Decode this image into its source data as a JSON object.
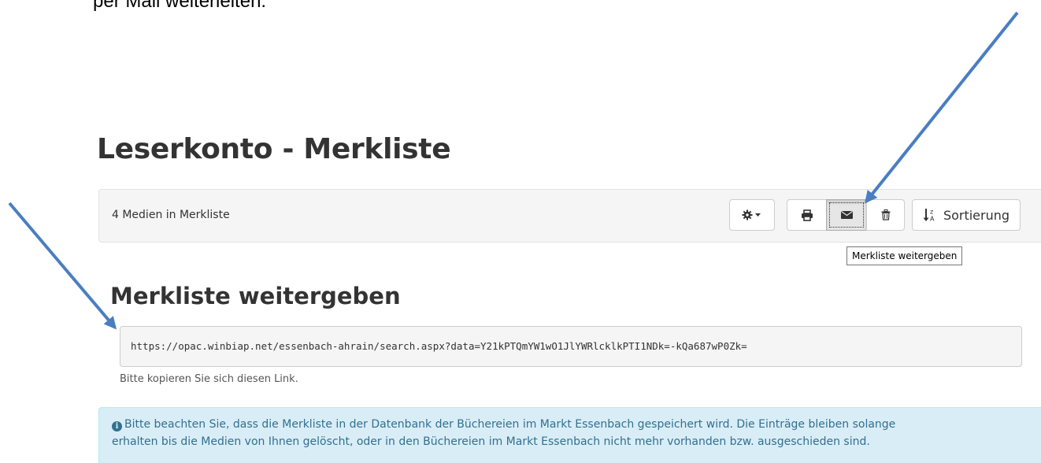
{
  "document": {
    "caption_fragment": "per Mail weiterleiten."
  },
  "page": {
    "title": "Leserkonto - Merkliste"
  },
  "toolbar": {
    "media_count": "4 Medien in Merkliste",
    "settings_icon": "gear-icon",
    "print_icon": "print-icon",
    "mail_icon": "envelope-icon",
    "delete_icon": "trash-icon",
    "sort_icon": "sort-alpha-icon",
    "sort_label": "Sortierung",
    "tooltip": "Merkliste weitergeben"
  },
  "share": {
    "heading": "Merkliste weitergeben",
    "link": "https://opac.winbiap.net/essenbach-ahrain/search.aspx?data=Y21kPTQmYW1wO1JlYWRlcklkPTI1NDk=-kQa687wP0Zk=",
    "hint": "Bitte kopieren Sie sich diesen Link."
  },
  "info": {
    "icon": "info-circle-icon",
    "line1": "Bitte beachten Sie, dass die Merkliste in der Datenbank der Büchereien im Markt Essenbach gespeichert wird. Die Einträge bleiben solange",
    "line2": "erhalten bis die Medien von Ihnen gelöscht, oder in den Büchereien im Markt Essenbach nicht mehr vorhanden bzw. ausgeschieden sind."
  },
  "colors": {
    "arrow": "#4a7ec2",
    "info_background": "#d9edf7",
    "info_text": "#31708f",
    "panel_background": "#f5f5f5"
  }
}
